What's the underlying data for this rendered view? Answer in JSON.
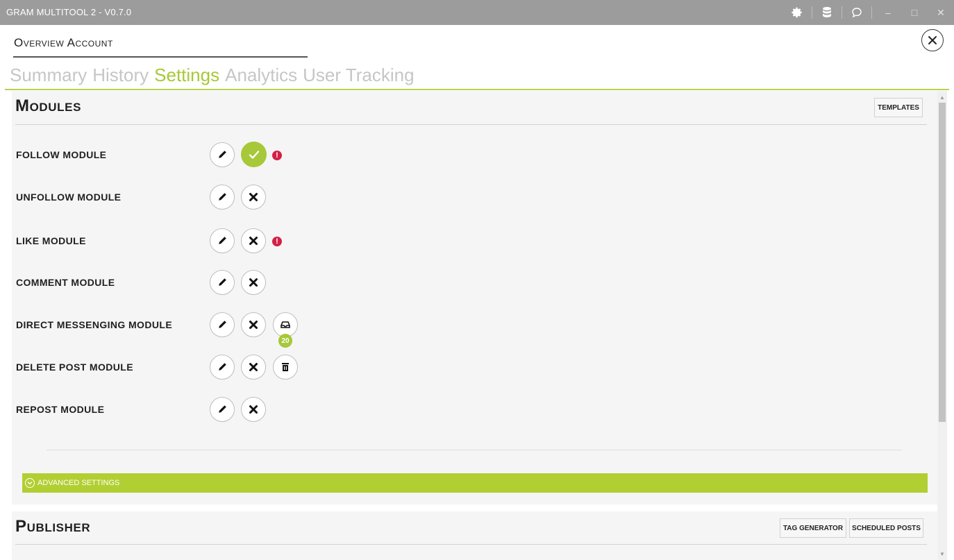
{
  "window": {
    "title": "GRAM MULTITOOL 2 - V0.7.0",
    "icons": [
      "gear-icon",
      "database-icon",
      "chat-icon"
    ],
    "controls": [
      "minimize-icon",
      "maximize-icon",
      "close-icon"
    ]
  },
  "header": {
    "title": "Overview Account",
    "close_icon": "close-circle-icon"
  },
  "tabs": [
    {
      "label": "Summary",
      "active": false
    },
    {
      "label": "History",
      "active": false
    },
    {
      "label": "Settings",
      "active": true
    },
    {
      "label": "Analytics",
      "active": false
    },
    {
      "label": "User Tracking",
      "active": false
    }
  ],
  "modules": {
    "title": "Modules",
    "templates_button": "TEMPLATES",
    "items": [
      {
        "label": "FOLLOW MODULE",
        "enabled": true,
        "warning": true
      },
      {
        "label": "UNFOLLOW MODULE",
        "enabled": false,
        "warning": false
      },
      {
        "label": "LIKE MODULE",
        "enabled": false,
        "warning": true
      },
      {
        "label": "COMMENT MODULE",
        "enabled": false,
        "warning": false
      },
      {
        "label": "DIRECT MESSENGING MODULE",
        "enabled": false,
        "warning": false,
        "inbox_count": "20"
      },
      {
        "label": "DELETE POST MODULE",
        "enabled": false,
        "warning": false,
        "extra": "trash-icon"
      },
      {
        "label": "REPOST MODULE",
        "enabled": false,
        "warning": false
      }
    ],
    "advanced_settings": "ADVANCED SETTINGS"
  },
  "publisher": {
    "title": "Publisher",
    "tag_generator_button": "TAG GENERATOR",
    "scheduled_posts_button": "SCHEDULED POSTS"
  },
  "colors": {
    "accent": "#a7c838",
    "advanced_bar": "#b1cf32",
    "warning": "#d41f46",
    "titlebar": "#9c9c9c"
  }
}
